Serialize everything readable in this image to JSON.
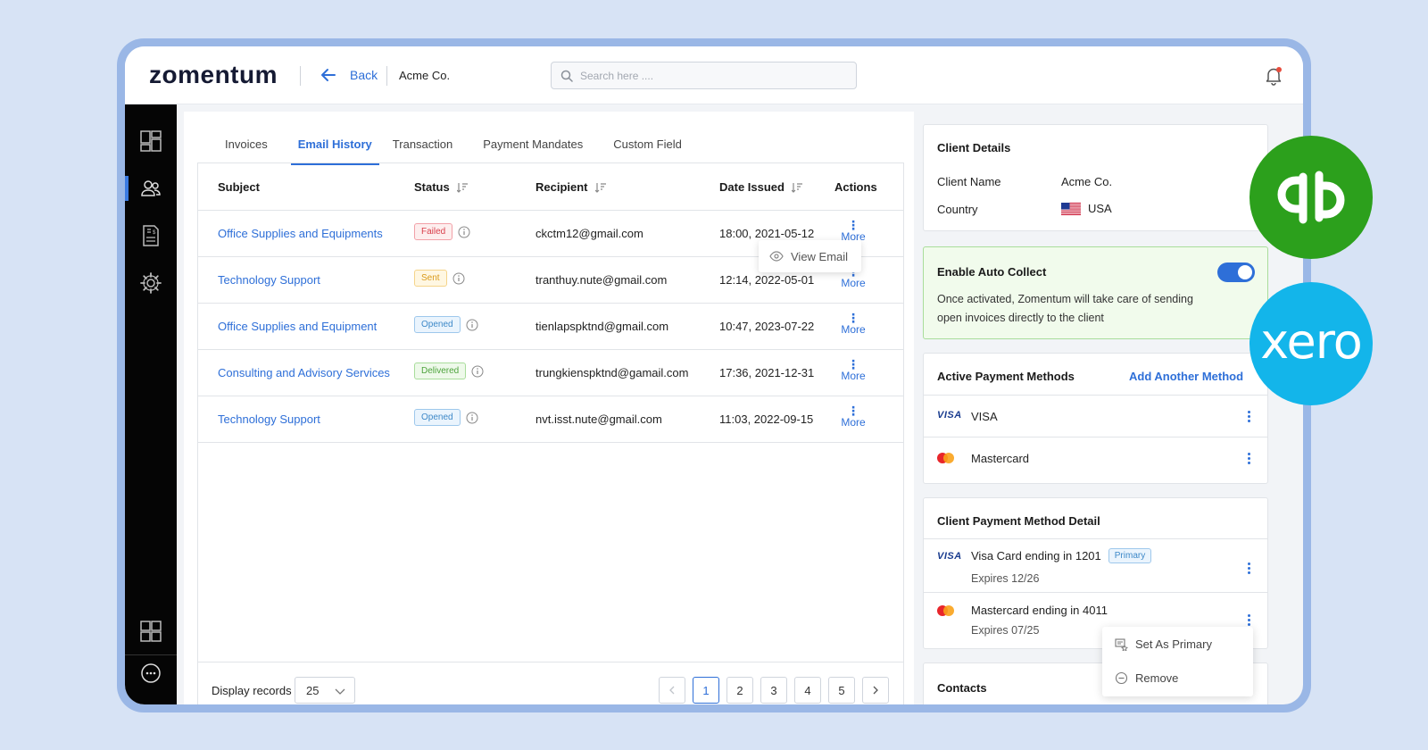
{
  "header": {
    "logo_text": "zomentum",
    "back_label": "Back",
    "breadcrumb": "Acme Co.",
    "search_placeholder": "Search here ...."
  },
  "sidebar": {
    "items": [
      "dashboard-icon",
      "clients-icon",
      "invoice-icon",
      "settings-icon"
    ],
    "bottom_items": [
      "apps-icon",
      "chat-icon"
    ],
    "active_index": 1
  },
  "tabs": [
    "Invoices",
    "Email History",
    "Transaction",
    "Payment Mandates",
    "Custom Field"
  ],
  "active_tab": 1,
  "table": {
    "columns": [
      "Subject",
      "Status",
      "Recipient",
      "Date Issued",
      "Actions"
    ],
    "rows": [
      {
        "subject": "Office Supplies and Equipments",
        "status": "Failed",
        "recipient": "ckctm12@gmail.com",
        "date": "18:00, 2021-05-12",
        "action": "More"
      },
      {
        "subject": "Technology Support",
        "status": "Sent",
        "recipient": "tranthuy.nute@gmail.com",
        "date": "12:14, 2022-05-01",
        "action": "More"
      },
      {
        "subject": "Office Supplies and Equipment",
        "status": "Opened",
        "recipient": "tienlapspktnd@gmail.com",
        "date": "10:47, 2023-07-22",
        "action": "More"
      },
      {
        "subject": "Consulting and Advisory Services",
        "status": "Delivered",
        "recipient": "trungkienspktnd@gamail.com",
        "date": "17:36, 2021-12-31",
        "action": "More"
      },
      {
        "subject": "Technology Support",
        "status": "Opened",
        "recipient": "nvt.isst.nute@gmail.com",
        "date": "11:03, 2022-09-15",
        "action": "More"
      }
    ],
    "view_email_popup": "View Email"
  },
  "footer": {
    "display_label": "Display records",
    "display_value": "25",
    "pages": [
      "1",
      "2",
      "3",
      "4",
      "5"
    ],
    "current_page": "1"
  },
  "client_details": {
    "title": "Client Details",
    "name_label": "Client Name",
    "name_value": "Acme Co.",
    "country_label": "Country",
    "country_value": "USA"
  },
  "auto_collect": {
    "title": "Enable Auto Collect",
    "enabled": true,
    "description": "Once activated, Zomentum will take care of sending open invoices directly to the client"
  },
  "payment_methods": {
    "title": "Active Payment Methods",
    "add_label": "Add Another Method",
    "items": [
      {
        "logo": "VISA",
        "name": "VISA"
      },
      {
        "logo": "mastercard-icon",
        "name": "Mastercard"
      }
    ]
  },
  "method_detail": {
    "title": "Client Payment Method Detail",
    "items": [
      {
        "logo": "VISA",
        "name": "Visa Card ending in 1201",
        "badge": "Primary",
        "expires": "Expires 12/26"
      },
      {
        "logo": "mastercard-icon",
        "name": "Mastercard ending in 4011",
        "badge": "",
        "expires": "Expires 07/25"
      }
    ]
  },
  "context_menu": {
    "set_primary": "Set As Primary",
    "remove": "Remove"
  },
  "contacts": {
    "title": "Contacts"
  },
  "integrations": {
    "quickbooks": "quickbooks-logo",
    "xero": "xero"
  },
  "colors": {
    "accent": "#2e6fd8",
    "quickbooks_green": "#2ca01c",
    "xero_blue": "#13b5ea"
  }
}
